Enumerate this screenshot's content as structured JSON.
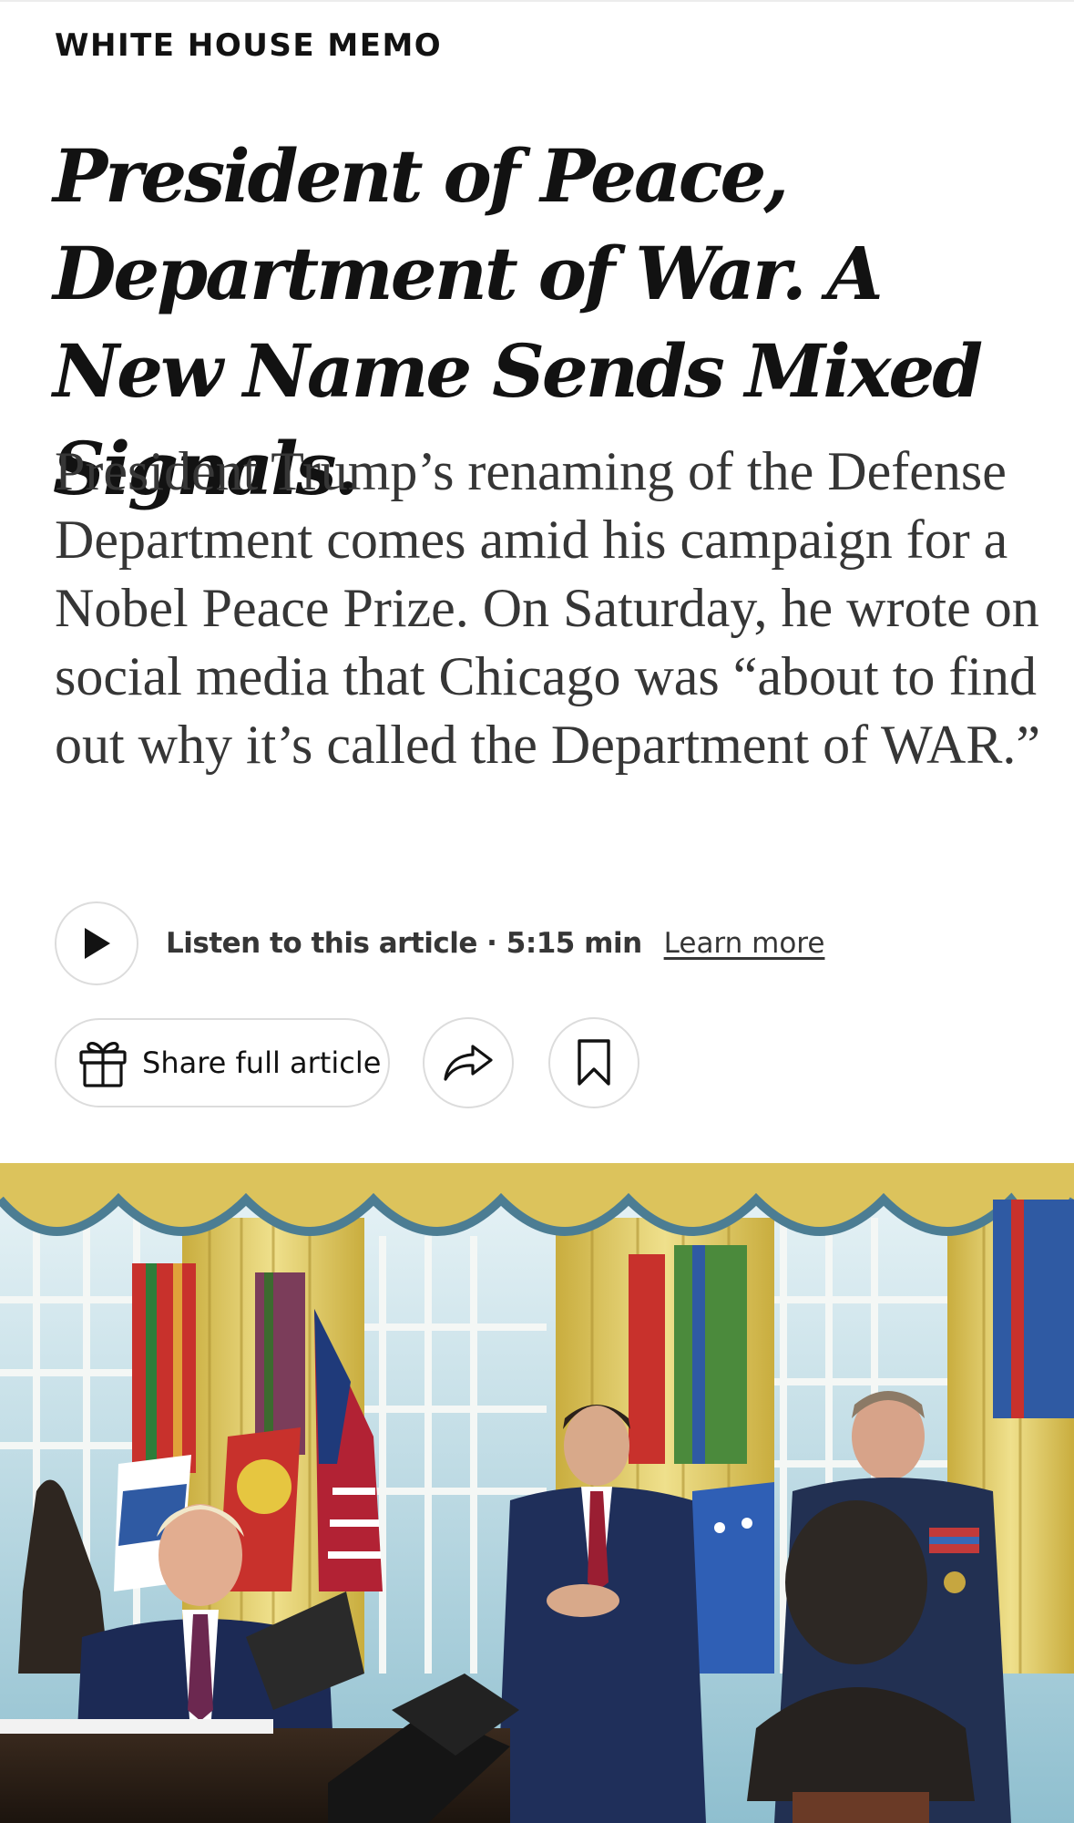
{
  "article": {
    "kicker": "WHITE HOUSE MEMO",
    "headline": "President of Peace, Department of War. A New Name Sends Mixed Signals.",
    "summary": "President Trump’s renaming of the Defense Department comes amid his campaign for a Nobel Peace Prize. On Saturday, he wrote on social media that Chicago was “about to find out why it’s called the Department of WAR.”"
  },
  "audio": {
    "play_icon": "play-icon",
    "listen_label": "Listen to this article · 5:15 min",
    "learn_more": "Learn more"
  },
  "actions": {
    "share_full_label": "Share full article",
    "gift_icon": "gift-icon",
    "share_icon": "share-arrow-icon",
    "bookmark_icon": "bookmark-icon"
  },
  "colors": {
    "text": "#121212",
    "summary": "#363636",
    "button_border": "#dcdcdc",
    "curtain_gold": "#d9c35a"
  }
}
